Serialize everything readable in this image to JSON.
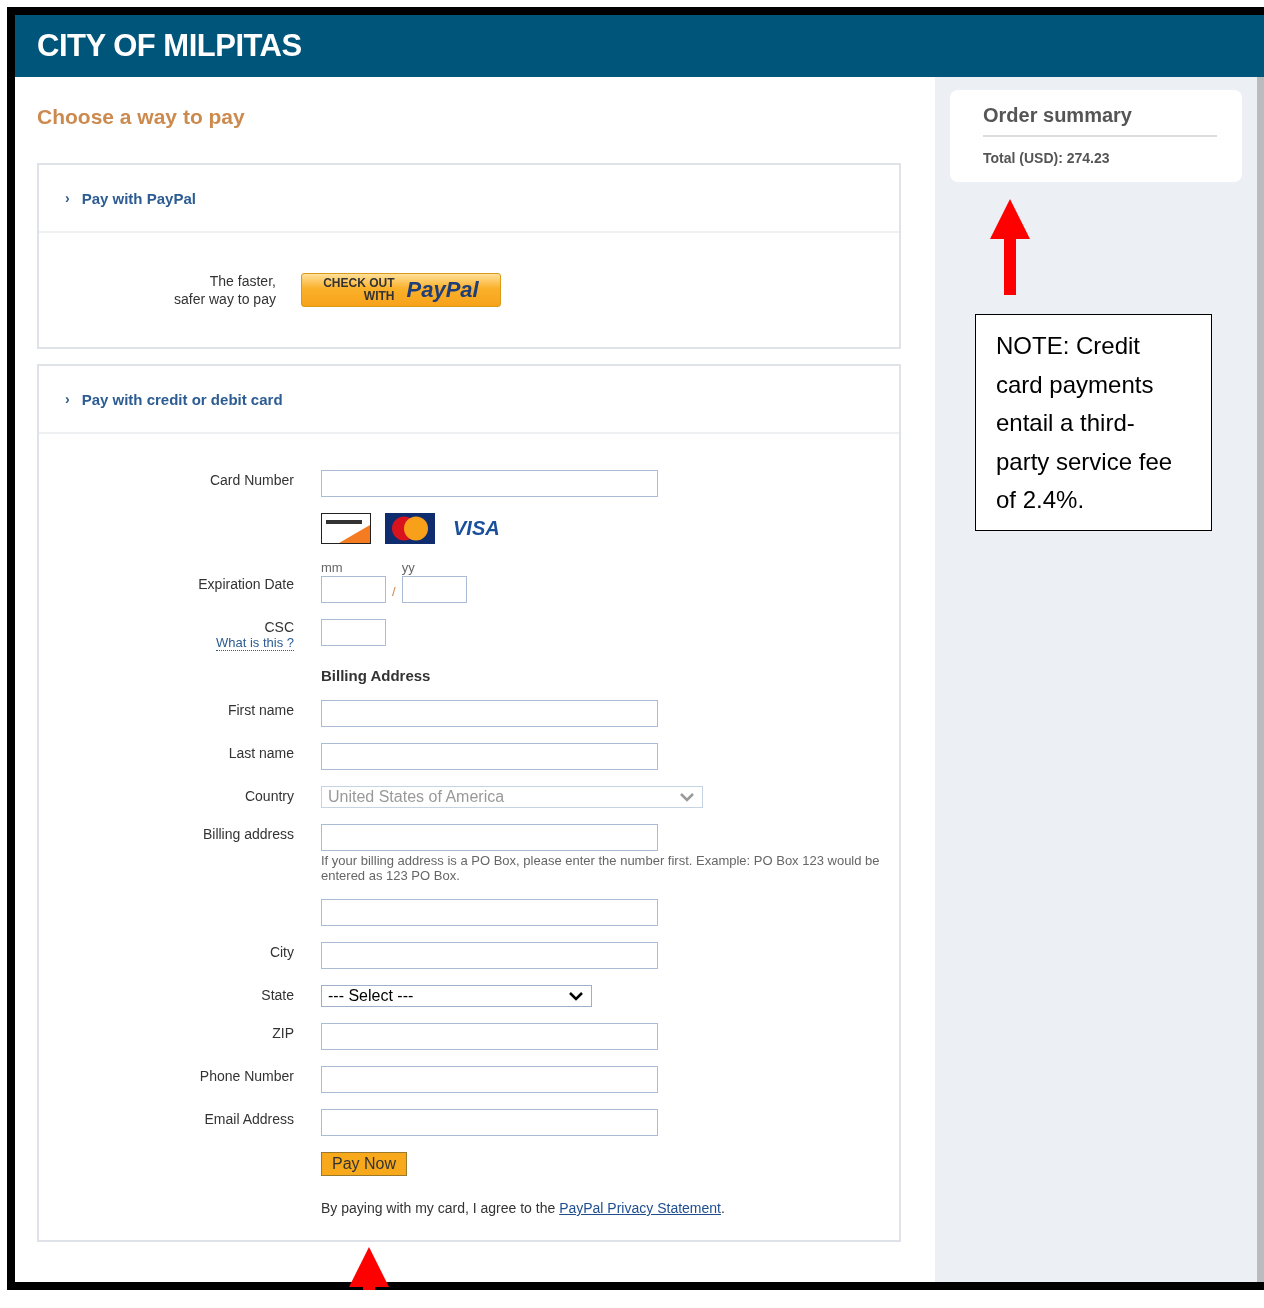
{
  "header": {
    "title": "CITY OF MILPITAS"
  },
  "main": {
    "heading": "Choose a way to pay"
  },
  "paypal_section": {
    "expander": "›",
    "title": "Pay with PayPal",
    "tagline": [
      "The faster,",
      "safer way to pay"
    ],
    "button": {
      "line_1": "CHECK OUT",
      "line_2": "WITH",
      "brand": "PayPal"
    }
  },
  "card_section": {
    "expander": "›",
    "title": "Pay with credit or debit card",
    "rows": [
      {
        "kind": "input",
        "label": "Card Number"
      },
      {
        "kind": "logos",
        "visa": "VISA"
      },
      {
        "kind": "expiry",
        "label": "Expiration Date",
        "month_hint": "mm",
        "separator": "/",
        "year_hint": "yy"
      },
      {
        "kind": "csc",
        "label": "CSC",
        "link": "What is this ?"
      },
      {
        "kind": "heading",
        "text": "Billing Address"
      },
      {
        "kind": "input",
        "label": "First name"
      },
      {
        "kind": "input",
        "label": "Last name"
      },
      {
        "kind": "select",
        "label": "Country",
        "value": "United States of America",
        "disabled": true
      },
      {
        "kind": "address",
        "label": "Billing address",
        "hint": "If your billing address is a PO Box, please enter the number first. Example: PO Box 123 would be entered as 123 PO Box."
      },
      {
        "kind": "input"
      },
      {
        "kind": "input",
        "label": "City"
      },
      {
        "kind": "select",
        "label": "State",
        "value": "--- Select ---",
        "disabled": false
      },
      {
        "kind": "input",
        "label": "ZIP"
      },
      {
        "kind": "input",
        "label": "Phone Number"
      },
      {
        "kind": "input",
        "label": "Email Address"
      },
      {
        "kind": "button",
        "label": "Pay Now"
      },
      {
        "kind": "consent",
        "text": "By paying with my card, I agree to the ",
        "link": "PayPal Privacy Statement",
        "end": "."
      }
    ]
  },
  "order_summary": {
    "title": "Order summary",
    "total": "Total (USD): 274.23"
  },
  "note": {
    "text": "NOTE: Credit card payments entail a third-party service fee of 2.4%."
  }
}
